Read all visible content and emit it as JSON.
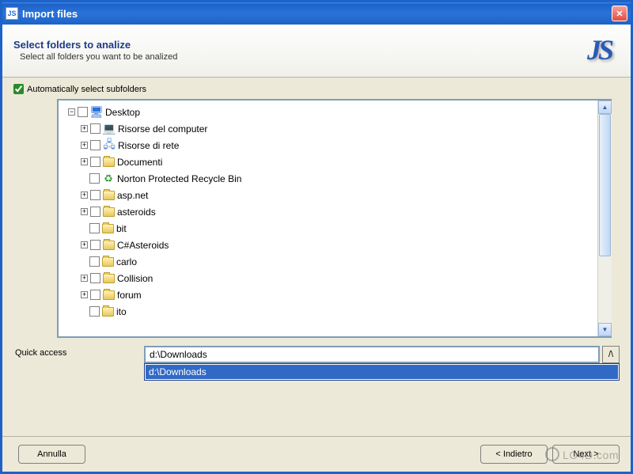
{
  "window": {
    "title": "Import files",
    "app_icon_text": "JS"
  },
  "header": {
    "title": "Select folders to analize",
    "subtitle": "Select all folders you want to be analized",
    "logo_text": "JS"
  },
  "options": {
    "auto_subfolders_label": "Automatically select subfolders",
    "auto_subfolders_checked": true
  },
  "tree": {
    "root": "Desktop",
    "items": [
      {
        "label": "Risorse del computer",
        "icon": "computer",
        "expandable": true
      },
      {
        "label": "Risorse di rete",
        "icon": "network",
        "expandable": true
      },
      {
        "label": "Documenti",
        "icon": "folder",
        "expandable": true
      },
      {
        "label": "Norton Protected Recycle Bin",
        "icon": "recycle",
        "expandable": false
      },
      {
        "label": "asp.net",
        "icon": "folder",
        "expandable": true
      },
      {
        "label": "asteroids",
        "icon": "folder",
        "expandable": true
      },
      {
        "label": "bit",
        "icon": "folder",
        "expandable": false
      },
      {
        "label": "C#Asteroids",
        "icon": "folder",
        "expandable": true
      },
      {
        "label": "carlo",
        "icon": "folder",
        "expandable": false
      },
      {
        "label": "Collision",
        "icon": "folder",
        "expandable": true
      },
      {
        "label": "forum",
        "icon": "folder",
        "expandable": true
      },
      {
        "label": "ito",
        "icon": "folder",
        "expandable": false
      }
    ]
  },
  "quick_access": {
    "label": "Quick access",
    "value": "d:\\Downloads",
    "button_glyph": "/\\",
    "dropdown_item": "d:\\Downloads"
  },
  "footer": {
    "cancel": "Annulla",
    "back": "< Indietro",
    "next": "Next >"
  },
  "watermark": "LO4D.com"
}
